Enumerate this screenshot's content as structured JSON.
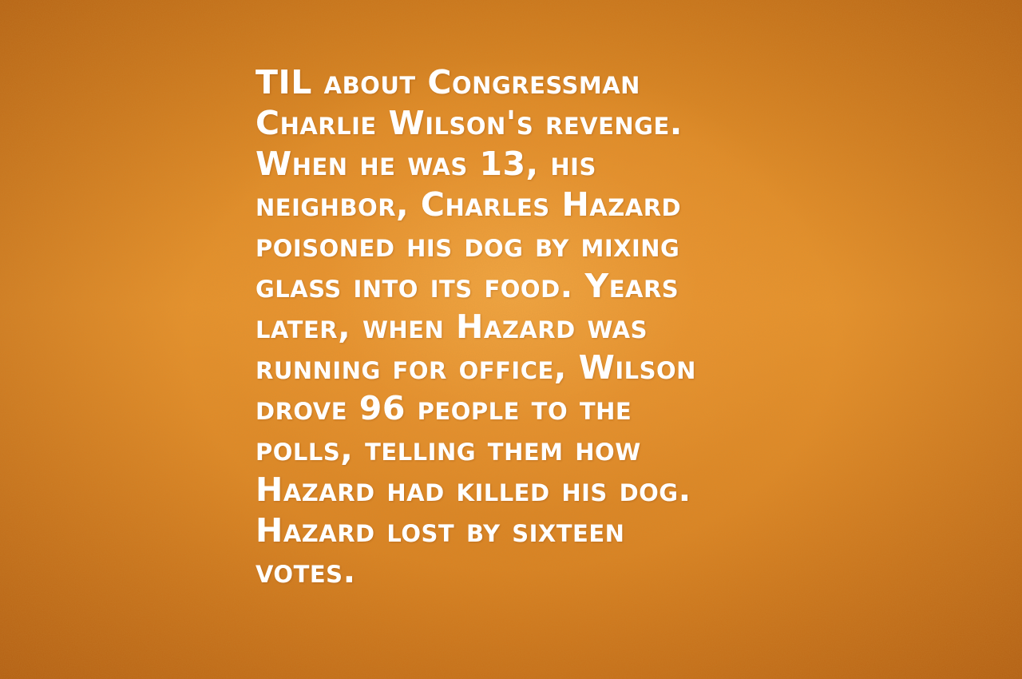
{
  "fact": {
    "lines": [
      "TIL about Congressman",
      "Charlie Wilson's revenge.",
      "When he was 13, his",
      "neighbor, Charles Hazard",
      "poisoned his dog by mixing",
      "glass into its food. Years",
      "later, when Hazard was",
      "running for office, Wilson",
      "drove 96 people to the",
      "polls, telling them how",
      "Hazard had killed his dog.",
      "Hazard lost by sixteen",
      "votes."
    ]
  },
  "colors": {
    "background": "#e48a24",
    "text": "#ffffff"
  }
}
